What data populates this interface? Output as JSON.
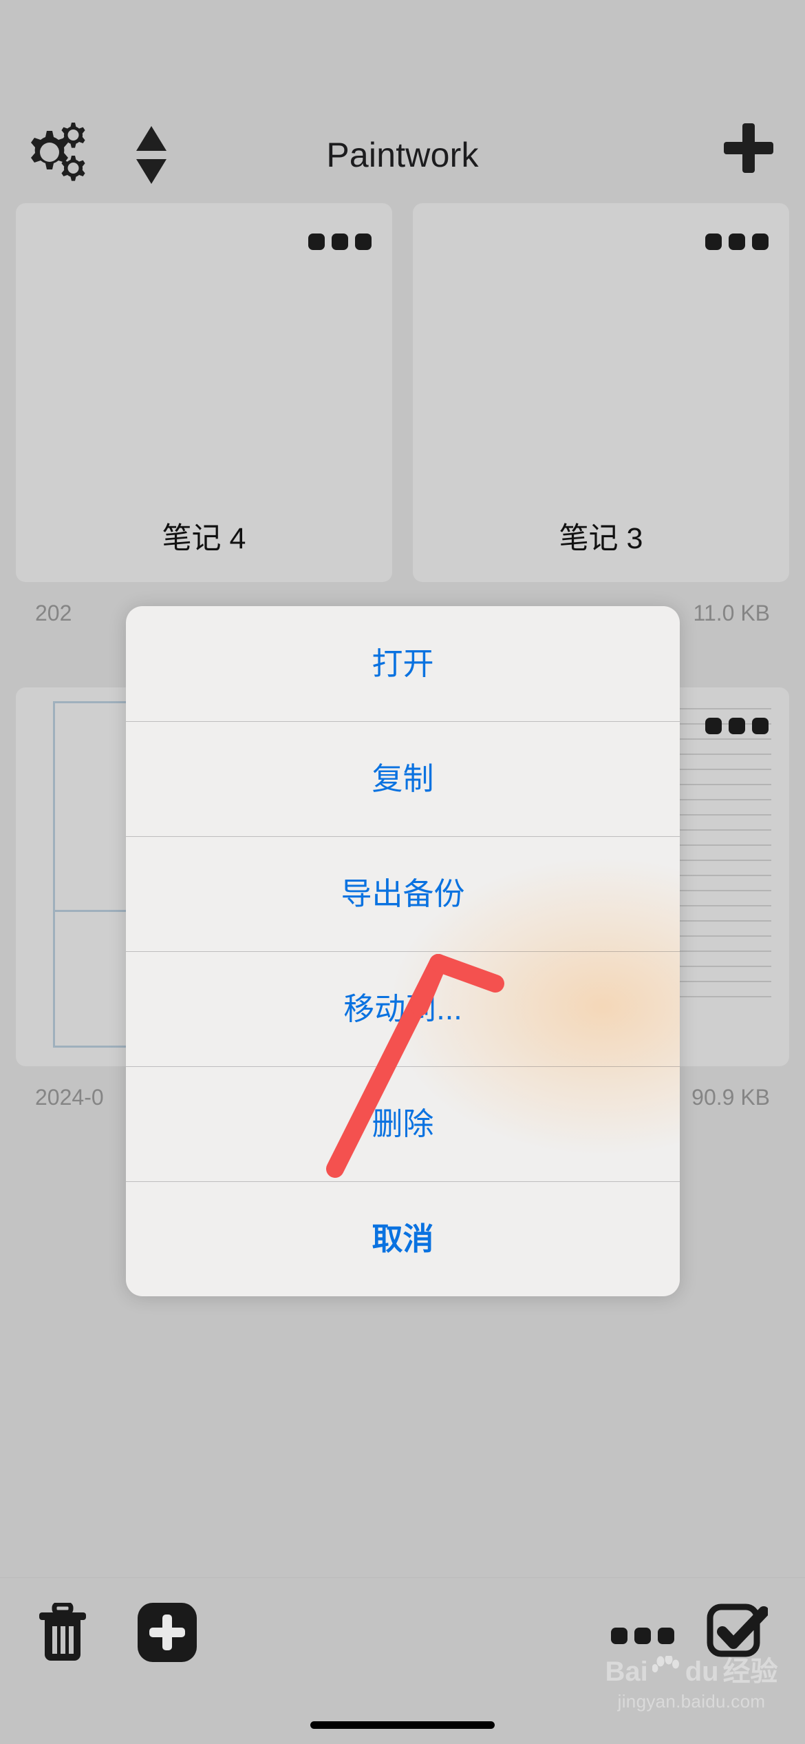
{
  "app": {
    "title": "Paintwork"
  },
  "nav": {
    "settings_icon": "gears-icon",
    "sort_icon": "sort-updown-icon",
    "add_icon": "plus-icon"
  },
  "notes": [
    {
      "name": "笔记 4",
      "date": "202",
      "size": "",
      "menu_icon": "more-dots-icon",
      "thumb": "blank"
    },
    {
      "name": "笔记 3",
      "date": "",
      "size": "11.0 KB",
      "menu_icon": "more-dots-icon",
      "thumb": "blank"
    },
    {
      "name": "",
      "date": "2024-0",
      "size": "",
      "menu_icon": "more-dots-icon",
      "thumb": "rect-outline"
    },
    {
      "name": "",
      "date": "",
      "size": "90.9 KB",
      "menu_icon": "more-dots-icon",
      "thumb": "ruled-lines"
    }
  ],
  "action_sheet": {
    "items": [
      {
        "label": "打开",
        "name": "open"
      },
      {
        "label": "复制",
        "name": "duplicate"
      },
      {
        "label": "导出备份",
        "name": "export-backup"
      },
      {
        "label": "移动到...",
        "name": "move-to"
      },
      {
        "label": "删除",
        "name": "delete"
      },
      {
        "label": "取消",
        "name": "cancel"
      }
    ],
    "tint_color": "#0a72e0",
    "background_color": "#f0efee"
  },
  "annotation": {
    "arrow_color": "#f4514f",
    "points_at": "移动到..."
  },
  "toolbar": {
    "trash_icon": "trash-icon",
    "add_icon": "add-box-icon",
    "more_icon": "more-dots-icon",
    "select_icon": "checkbox-checked-icon"
  },
  "watermark": {
    "brand_bai": "Bai",
    "brand_du": "du",
    "brand_suffix": "经验",
    "url": "jingyan.baidu.com"
  }
}
